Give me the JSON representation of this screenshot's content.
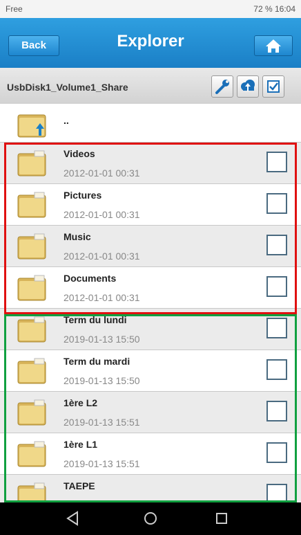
{
  "status_bar": {
    "carrier": "Free",
    "battery": "72 %",
    "time": "16:04"
  },
  "header": {
    "back_label": "Back",
    "title": "Explorer",
    "home_icon": "home-icon"
  },
  "path_bar": {
    "path": "UsbDisk1_Volume1_Share",
    "tools": [
      "wrench-icon",
      "upload-cloud-icon",
      "select-all-icon"
    ]
  },
  "up_item": {
    "name": ".."
  },
  "items": [
    {
      "name": "Videos",
      "date": "2012-01-01 00:31",
      "checked": false
    },
    {
      "name": "Pictures",
      "date": "2012-01-01 00:31",
      "checked": false
    },
    {
      "name": "Music",
      "date": "2012-01-01 00:31",
      "checked": false
    },
    {
      "name": "Documents",
      "date": "2012-01-01 00:31",
      "checked": false
    },
    {
      "name": "Term du lundi",
      "date": "2019-01-13 15:50",
      "checked": false
    },
    {
      "name": "Term du mardi",
      "date": "2019-01-13 15:50",
      "checked": false
    },
    {
      "name": "1ère L2",
      "date": "2019-01-13 15:51",
      "checked": false
    },
    {
      "name": "1ère L1",
      "date": "2019-01-13 15:51",
      "checked": false
    },
    {
      "name": "TAEPE",
      "date": "",
      "checked": false
    }
  ],
  "colors": {
    "header": "#1a7fc6",
    "highlight_red": "#e01010",
    "highlight_green": "#10a040"
  },
  "nav": [
    "back-triangle-icon",
    "home-circle-icon",
    "recents-square-icon"
  ]
}
